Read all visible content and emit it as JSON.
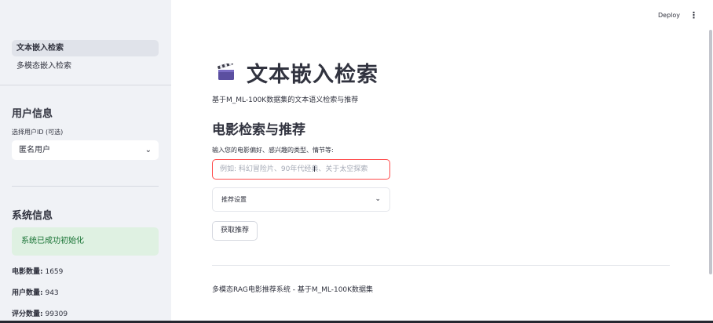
{
  "header": {
    "deploy_label": "Deploy",
    "menu_icon": "kebab-menu-icon"
  },
  "sidebar": {
    "nav": [
      {
        "label": "文本嵌入检索",
        "active": true
      },
      {
        "label": "多模态嵌入检索",
        "active": false
      }
    ],
    "user_section": {
      "title": "用户信息",
      "select_label": "选择用户ID (可选)",
      "select_value": "匿名用户"
    },
    "system_section": {
      "title": "系统信息",
      "status": "系统已成功初始化",
      "stats": [
        {
          "label": "电影数量:",
          "value": "1659"
        },
        {
          "label": "用户数量:",
          "value": "943"
        },
        {
          "label": "评分数量:",
          "value": "99309"
        }
      ]
    }
  },
  "main": {
    "title_icon": "clapper-board-icon",
    "title": "文本嵌入检索",
    "subtitle": "基于M_ML-100K数据集的文本语义检索与推荐",
    "section_title": "电影检索与推荐",
    "input_label": "输入您的电影偏好、感兴趣的类型、情节等:",
    "input_placeholder": "例如: 科幻冒险片、90年代经典、关于太空探索",
    "expander_label": "推荐设置",
    "button_label": "获取推荐",
    "footer": "多模态RAG电影推荐系统 - 基于M_ML-100K数据集"
  },
  "colors": {
    "accent": "#ff4b4b",
    "success_bg": "#dff1e2",
    "success_text": "#177233",
    "sidebar_bg": "#f0f2f6"
  }
}
